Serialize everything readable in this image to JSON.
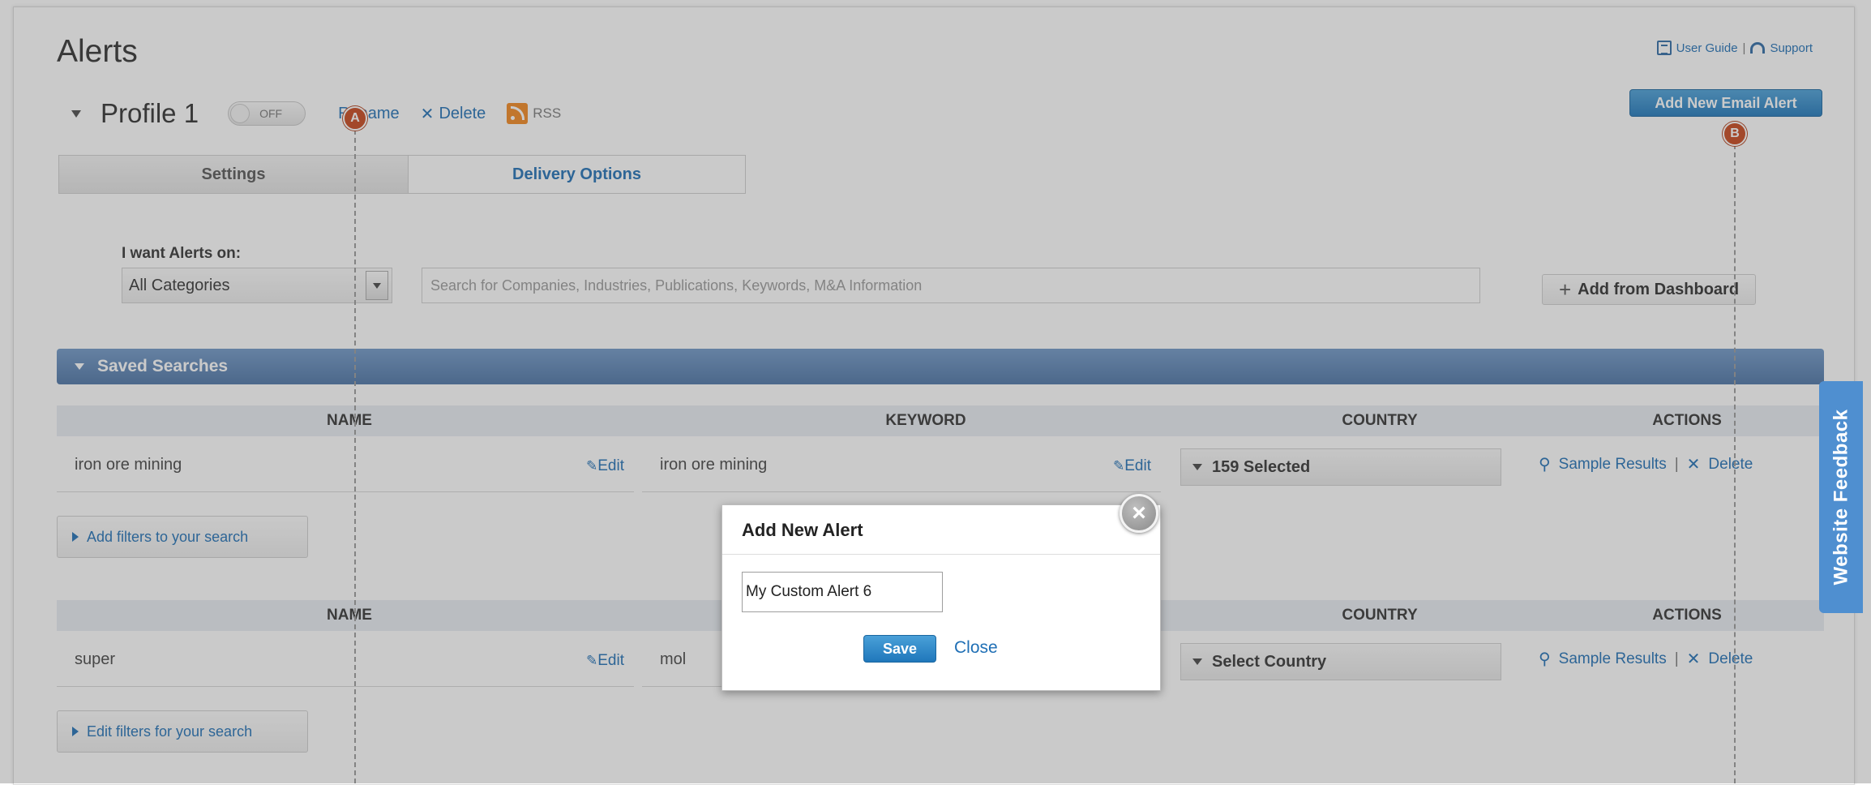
{
  "page": {
    "title": "Alerts",
    "top_links": {
      "user_guide": "User Guide",
      "separator": "|",
      "support": "Support"
    },
    "add_new_alert_button": "Add New Email Alert"
  },
  "markers": {
    "a": "A",
    "b": "B"
  },
  "profile": {
    "name": "Profile 1",
    "toggle_state": "OFF",
    "rename": "Rename",
    "delete": "Delete",
    "rss": "RSS"
  },
  "tabs": [
    {
      "label": "Settings"
    },
    {
      "label": "Delivery Options"
    }
  ],
  "filters": {
    "label": "I want Alerts on:",
    "category": "All Categories",
    "search_placeholder": "Search for Companies, Industries, Publications, Keywords, M&A Information",
    "add_from_dashboard": "Add from Dashboard"
  },
  "saved_searches": {
    "title": "Saved Searches",
    "columns": {
      "name": "NAME",
      "keyword": "KEYWORD",
      "country": "COUNTRY",
      "actions": "ACTIONS"
    },
    "edit_label": "Edit",
    "sample_results": "Sample Results",
    "delete": "Delete",
    "separator": "|",
    "rows": [
      {
        "name": "iron ore mining",
        "keyword": "iron ore mining",
        "country": "159 Selected",
        "filter_button": "Add filters to your search"
      },
      {
        "name": "super",
        "keyword": "mol",
        "country": "Select Country",
        "filter_button": "Edit filters for your search"
      }
    ]
  },
  "feedback_tab": "Website Feedback",
  "dialog": {
    "title": "Add New Alert",
    "input_value": "My Custom Alert 6",
    "save": "Save",
    "close": "Close",
    "close_icon": "×"
  },
  "colors": {
    "accent_blue": "#1f77bb",
    "saved_bar": "#4b73a5",
    "marker_orange": "#c7461b",
    "rss_orange": "#f3871f",
    "feedback_blue": "#4f8fd0"
  },
  "icons": [
    "user-guide-icon",
    "support-icon",
    "rss-icon",
    "pencil-icon",
    "person-icon",
    "close-icon",
    "plus-icon"
  ]
}
